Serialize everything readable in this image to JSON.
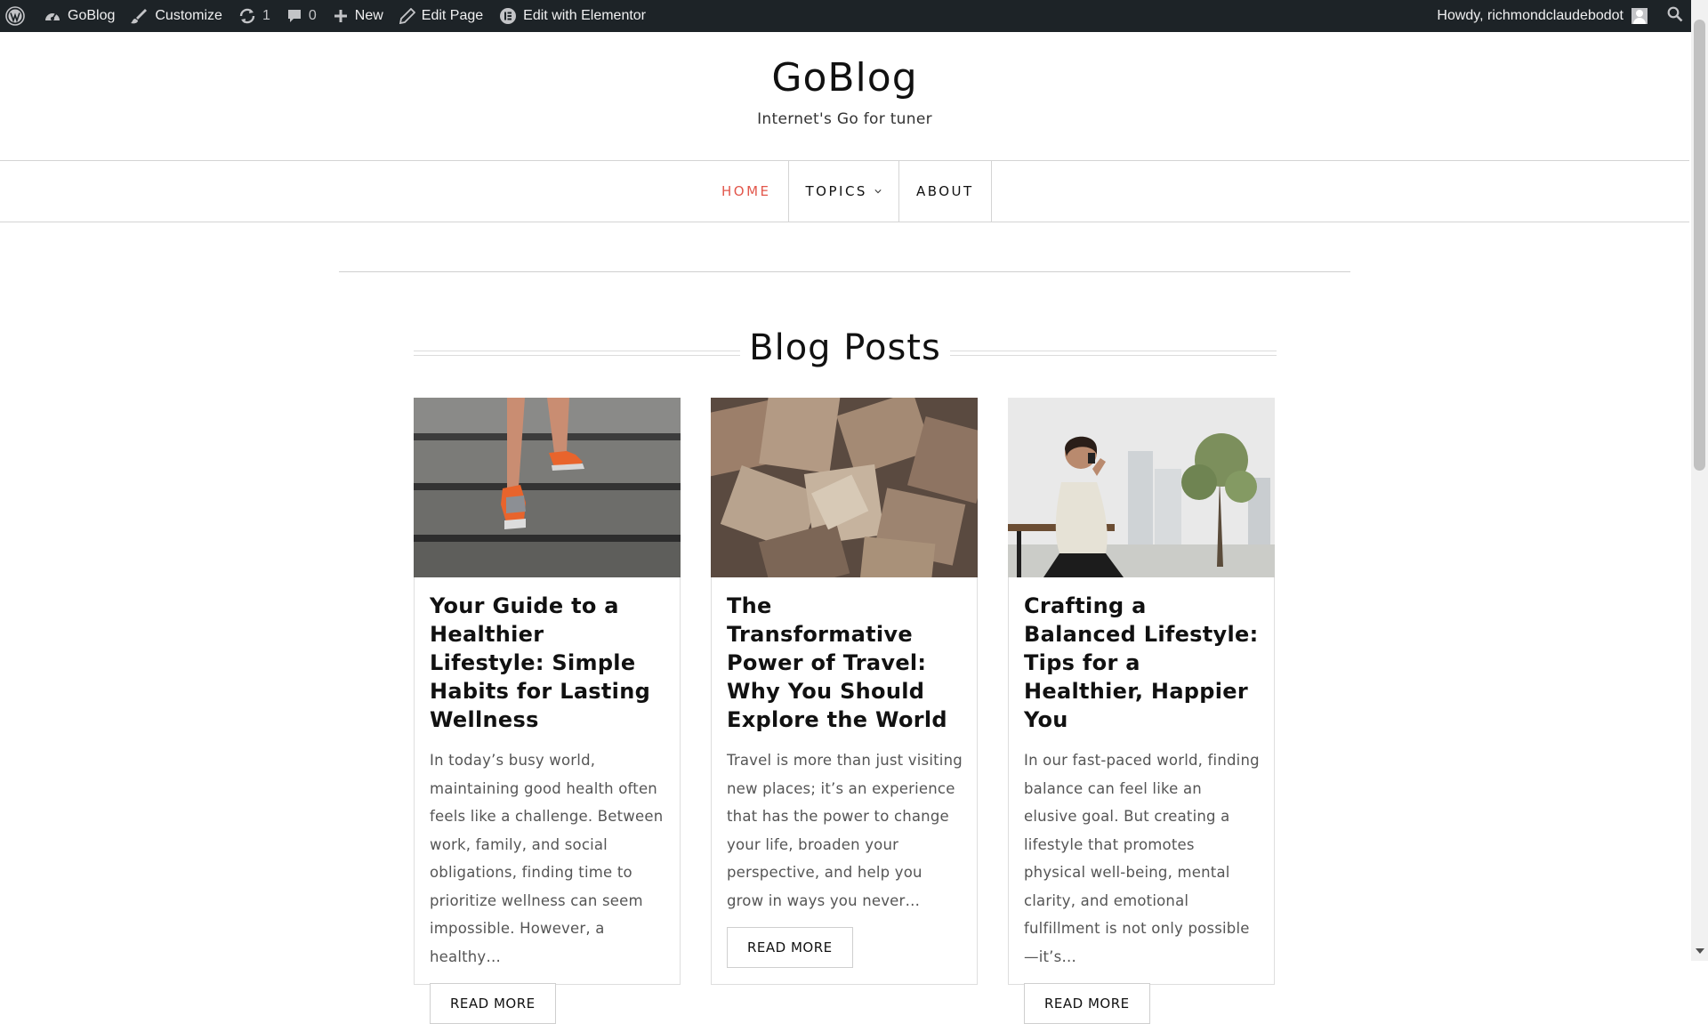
{
  "admin_bar": {
    "site_name": "GoBlog",
    "customize": "Customize",
    "updates_count": "1",
    "comments_count": "0",
    "new_label": "New",
    "edit_page": "Edit Page",
    "edit_elementor": "Edit with Elementor",
    "greeting": "Howdy, richmondclaudebodot"
  },
  "site": {
    "title": "GoBlog",
    "tagline": "Internet's Go for tuner"
  },
  "nav": {
    "items": [
      {
        "label": "HOME",
        "active": true
      },
      {
        "label": "TOPICS",
        "has_dropdown": true
      },
      {
        "label": "ABOUT"
      }
    ]
  },
  "section": {
    "heading": "Blog Posts"
  },
  "posts": [
    {
      "image": "running-shoes-on-stairs",
      "title": "Your Guide to a Healthier Lifestyle: Simple Habits for Lasting Wellness",
      "excerpt": "In today’s busy world, maintaining good health often feels like a challenge. Between work, family, and social obligations, finding time to prioritize wellness can seem impossible. However, a healthy…",
      "button": "READ MORE"
    },
    {
      "image": "scattered-maps",
      "title": "The Transformative Power of Travel: Why You Should Explore the World",
      "excerpt": "Travel is more than just visiting new places; it’s an experience that has the power to change your life, broaden your perspective, and help you grow in ways you never…",
      "button": "READ MORE"
    },
    {
      "image": "woman-on-phone-outdoors",
      "title": "Crafting a Balanced Lifestyle: Tips for a Healthier, Happier You",
      "excerpt": "In our fast-paced world, finding balance can feel like an elusive goal. But creating a lifestyle that promotes physical well-being, mental clarity, and emotional fulfillment is not only possible—it’s…",
      "button": "READ MORE"
    }
  ],
  "colors": {
    "admin_bar_bg": "#1d2327",
    "accent": "#e2574c",
    "text": "#111111",
    "border": "#d4d4d4"
  }
}
